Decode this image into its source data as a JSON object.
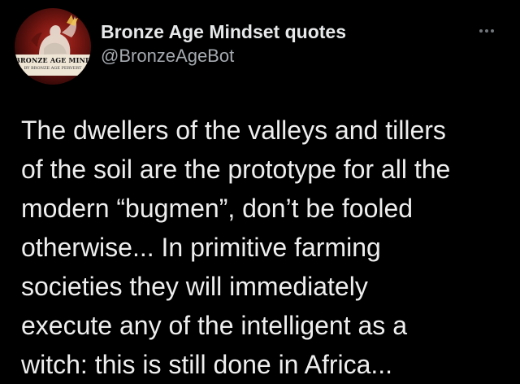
{
  "tweet": {
    "author": {
      "display_name": "Bronze Age Mindset quotes",
      "handle": "@BronzeAgeBot",
      "avatar": {
        "icon": "avatar-image",
        "title_text": "BRONZE AGE MINDSET",
        "sub_text": "BY BRONZE AGE PERVERT"
      }
    },
    "more_icon": "more-options-icon",
    "text_lines": [
      "The dwellers of the valleys and tillers",
      "of the soil are the prototype for all the",
      "modern “bugmen”, don’t be fooled",
      "otherwise... In primitive farming",
      "societies they will immediately",
      "execute any of the intelligent as a",
      "witch: this is still done in Africa..."
    ]
  },
  "colors": {
    "background": "#000000",
    "text_primary": "#e7e9ea",
    "text_secondary": "#a5aab0",
    "avatar_red": "#b52c22"
  }
}
